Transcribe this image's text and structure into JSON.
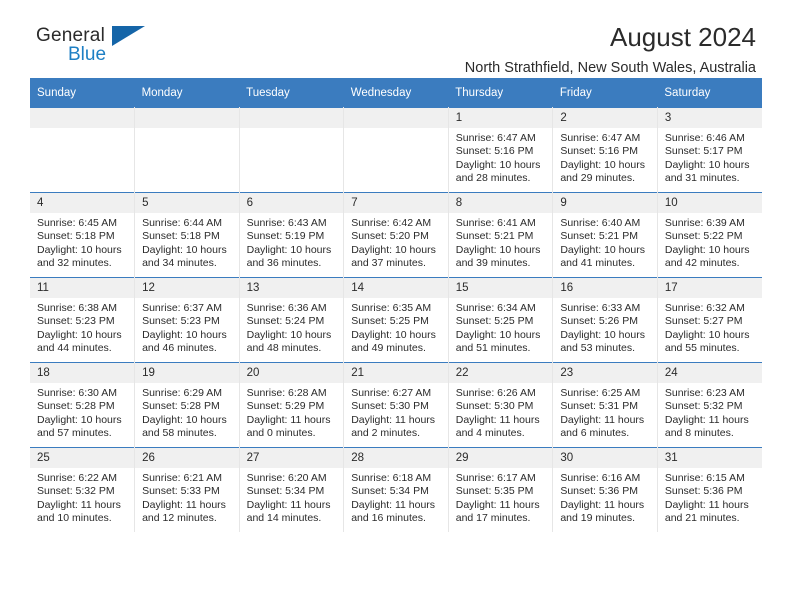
{
  "brand": {
    "name_part1": "General",
    "name_part2": "Blue",
    "accent_color": "#1d7fc4",
    "triangle_color": "#1565a8"
  },
  "header": {
    "title": "August 2024",
    "location": "North Strathfield, New South Wales, Australia",
    "header_bg": "#3b7cbf",
    "header_text_color": "#ffffff"
  },
  "calendar": {
    "weekday_headers": [
      "Sunday",
      "Monday",
      "Tuesday",
      "Wednesday",
      "Thursday",
      "Friday",
      "Saturday"
    ],
    "weeks": [
      [
        {
          "day": "",
          "empty": true,
          "sunrise": "",
          "sunset": "",
          "daylight_line1": "",
          "daylight_line2": ""
        },
        {
          "day": "",
          "empty": true,
          "sunrise": "",
          "sunset": "",
          "daylight_line1": "",
          "daylight_line2": ""
        },
        {
          "day": "",
          "empty": true,
          "sunrise": "",
          "sunset": "",
          "daylight_line1": "",
          "daylight_line2": ""
        },
        {
          "day": "",
          "empty": true,
          "sunrise": "",
          "sunset": "",
          "daylight_line1": "",
          "daylight_line2": ""
        },
        {
          "day": "1",
          "sunrise": "Sunrise: 6:47 AM",
          "sunset": "Sunset: 5:16 PM",
          "daylight_line1": "Daylight: 10 hours",
          "daylight_line2": "and 28 minutes."
        },
        {
          "day": "2",
          "sunrise": "Sunrise: 6:47 AM",
          "sunset": "Sunset: 5:16 PM",
          "daylight_line1": "Daylight: 10 hours",
          "daylight_line2": "and 29 minutes."
        },
        {
          "day": "3",
          "sunrise": "Sunrise: 6:46 AM",
          "sunset": "Sunset: 5:17 PM",
          "daylight_line1": "Daylight: 10 hours",
          "daylight_line2": "and 31 minutes."
        }
      ],
      [
        {
          "day": "4",
          "sunrise": "Sunrise: 6:45 AM",
          "sunset": "Sunset: 5:18 PM",
          "daylight_line1": "Daylight: 10 hours",
          "daylight_line2": "and 32 minutes."
        },
        {
          "day": "5",
          "sunrise": "Sunrise: 6:44 AM",
          "sunset": "Sunset: 5:18 PM",
          "daylight_line1": "Daylight: 10 hours",
          "daylight_line2": "and 34 minutes."
        },
        {
          "day": "6",
          "sunrise": "Sunrise: 6:43 AM",
          "sunset": "Sunset: 5:19 PM",
          "daylight_line1": "Daylight: 10 hours",
          "daylight_line2": "and 36 minutes."
        },
        {
          "day": "7",
          "sunrise": "Sunrise: 6:42 AM",
          "sunset": "Sunset: 5:20 PM",
          "daylight_line1": "Daylight: 10 hours",
          "daylight_line2": "and 37 minutes."
        },
        {
          "day": "8",
          "sunrise": "Sunrise: 6:41 AM",
          "sunset": "Sunset: 5:21 PM",
          "daylight_line1": "Daylight: 10 hours",
          "daylight_line2": "and 39 minutes."
        },
        {
          "day": "9",
          "sunrise": "Sunrise: 6:40 AM",
          "sunset": "Sunset: 5:21 PM",
          "daylight_line1": "Daylight: 10 hours",
          "daylight_line2": "and 41 minutes."
        },
        {
          "day": "10",
          "sunrise": "Sunrise: 6:39 AM",
          "sunset": "Sunset: 5:22 PM",
          "daylight_line1": "Daylight: 10 hours",
          "daylight_line2": "and 42 minutes."
        }
      ],
      [
        {
          "day": "11",
          "sunrise": "Sunrise: 6:38 AM",
          "sunset": "Sunset: 5:23 PM",
          "daylight_line1": "Daylight: 10 hours",
          "daylight_line2": "and 44 minutes."
        },
        {
          "day": "12",
          "sunrise": "Sunrise: 6:37 AM",
          "sunset": "Sunset: 5:23 PM",
          "daylight_line1": "Daylight: 10 hours",
          "daylight_line2": "and 46 minutes."
        },
        {
          "day": "13",
          "sunrise": "Sunrise: 6:36 AM",
          "sunset": "Sunset: 5:24 PM",
          "daylight_line1": "Daylight: 10 hours",
          "daylight_line2": "and 48 minutes."
        },
        {
          "day": "14",
          "sunrise": "Sunrise: 6:35 AM",
          "sunset": "Sunset: 5:25 PM",
          "daylight_line1": "Daylight: 10 hours",
          "daylight_line2": "and 49 minutes."
        },
        {
          "day": "15",
          "sunrise": "Sunrise: 6:34 AM",
          "sunset": "Sunset: 5:25 PM",
          "daylight_line1": "Daylight: 10 hours",
          "daylight_line2": "and 51 minutes."
        },
        {
          "day": "16",
          "sunrise": "Sunrise: 6:33 AM",
          "sunset": "Sunset: 5:26 PM",
          "daylight_line1": "Daylight: 10 hours",
          "daylight_line2": "and 53 minutes."
        },
        {
          "day": "17",
          "sunrise": "Sunrise: 6:32 AM",
          "sunset": "Sunset: 5:27 PM",
          "daylight_line1": "Daylight: 10 hours",
          "daylight_line2": "and 55 minutes."
        }
      ],
      [
        {
          "day": "18",
          "sunrise": "Sunrise: 6:30 AM",
          "sunset": "Sunset: 5:28 PM",
          "daylight_line1": "Daylight: 10 hours",
          "daylight_line2": "and 57 minutes."
        },
        {
          "day": "19",
          "sunrise": "Sunrise: 6:29 AM",
          "sunset": "Sunset: 5:28 PM",
          "daylight_line1": "Daylight: 10 hours",
          "daylight_line2": "and 58 minutes."
        },
        {
          "day": "20",
          "sunrise": "Sunrise: 6:28 AM",
          "sunset": "Sunset: 5:29 PM",
          "daylight_line1": "Daylight: 11 hours",
          "daylight_line2": "and 0 minutes."
        },
        {
          "day": "21",
          "sunrise": "Sunrise: 6:27 AM",
          "sunset": "Sunset: 5:30 PM",
          "daylight_line1": "Daylight: 11 hours",
          "daylight_line2": "and 2 minutes."
        },
        {
          "day": "22",
          "sunrise": "Sunrise: 6:26 AM",
          "sunset": "Sunset: 5:30 PM",
          "daylight_line1": "Daylight: 11 hours",
          "daylight_line2": "and 4 minutes."
        },
        {
          "day": "23",
          "sunrise": "Sunrise: 6:25 AM",
          "sunset": "Sunset: 5:31 PM",
          "daylight_line1": "Daylight: 11 hours",
          "daylight_line2": "and 6 minutes."
        },
        {
          "day": "24",
          "sunrise": "Sunrise: 6:23 AM",
          "sunset": "Sunset: 5:32 PM",
          "daylight_line1": "Daylight: 11 hours",
          "daylight_line2": "and 8 minutes."
        }
      ],
      [
        {
          "day": "25",
          "sunrise": "Sunrise: 6:22 AM",
          "sunset": "Sunset: 5:32 PM",
          "daylight_line1": "Daylight: 11 hours",
          "daylight_line2": "and 10 minutes."
        },
        {
          "day": "26",
          "sunrise": "Sunrise: 6:21 AM",
          "sunset": "Sunset: 5:33 PM",
          "daylight_line1": "Daylight: 11 hours",
          "daylight_line2": "and 12 minutes."
        },
        {
          "day": "27",
          "sunrise": "Sunrise: 6:20 AM",
          "sunset": "Sunset: 5:34 PM",
          "daylight_line1": "Daylight: 11 hours",
          "daylight_line2": "and 14 minutes."
        },
        {
          "day": "28",
          "sunrise": "Sunrise: 6:18 AM",
          "sunset": "Sunset: 5:34 PM",
          "daylight_line1": "Daylight: 11 hours",
          "daylight_line2": "and 16 minutes."
        },
        {
          "day": "29",
          "sunrise": "Sunrise: 6:17 AM",
          "sunset": "Sunset: 5:35 PM",
          "daylight_line1": "Daylight: 11 hours",
          "daylight_line2": "and 17 minutes."
        },
        {
          "day": "30",
          "sunrise": "Sunrise: 6:16 AM",
          "sunset": "Sunset: 5:36 PM",
          "daylight_line1": "Daylight: 11 hours",
          "daylight_line2": "and 19 minutes."
        },
        {
          "day": "31",
          "sunrise": "Sunrise: 6:15 AM",
          "sunset": "Sunset: 5:36 PM",
          "daylight_line1": "Daylight: 11 hours",
          "daylight_line2": "and 21 minutes."
        }
      ]
    ]
  }
}
